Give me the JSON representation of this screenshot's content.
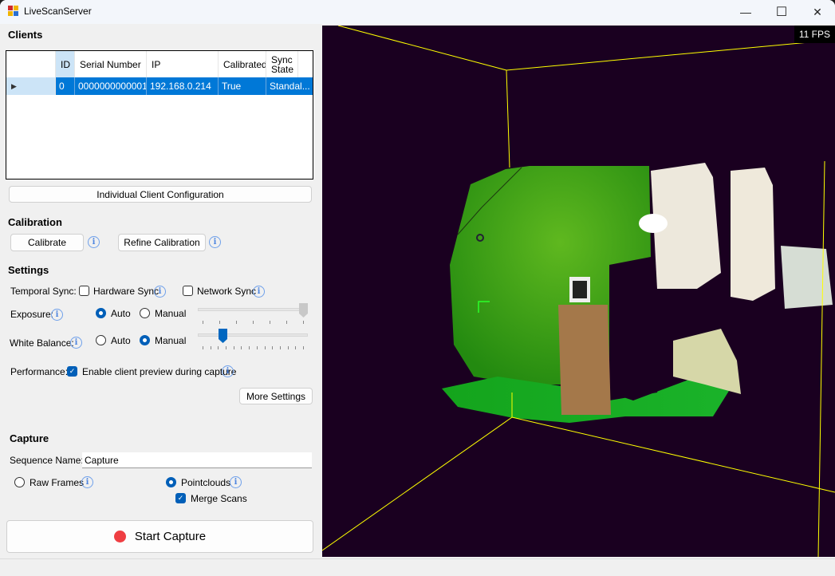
{
  "window": {
    "title": "LiveScanServer",
    "controls": {
      "minimize": "—",
      "maximize": "☐",
      "close": "✕"
    }
  },
  "clients": {
    "heading": "Clients",
    "columns": [
      "ID",
      "Serial Number",
      "IP",
      "Calibrated",
      "Sync State"
    ],
    "rows": [
      {
        "id": "0",
        "serial": "0000000000001",
        "ip": "192.168.0.214",
        "calibrated": "True",
        "sync_state": "Standal..."
      }
    ],
    "row_marker": "▶",
    "config_button": "Individual Client Configuration"
  },
  "calibration": {
    "heading": "Calibration",
    "calibrate_button": "Calibrate",
    "refine_button": "Refine Calibration"
  },
  "settings": {
    "heading": "Settings",
    "temporal_sync_label": "Temporal Sync:",
    "hardware_sync": {
      "label": "Hardware Sync",
      "checked": false
    },
    "network_sync": {
      "label": "Network Sync",
      "checked": false
    },
    "exposure": {
      "label": "Exposure:",
      "auto_label": "Auto",
      "manual_label": "Manual",
      "mode": "Auto",
      "slider_value": 1.0,
      "ticks": 7,
      "enabled": false
    },
    "white_balance": {
      "label": "White Balance:",
      "auto_label": "Auto",
      "manual_label": "Manual",
      "mode": "Manual",
      "slider_value": 0.2,
      "ticks": 14,
      "enabled": true
    },
    "performance_label": "Performance:",
    "client_preview": {
      "label": "Enable client preview during capture",
      "checked": true
    },
    "more_settings_button": "More Settings"
  },
  "capture": {
    "heading": "Capture",
    "sequence_name_label": "Sequence Name:",
    "sequence_name_value": "Capture",
    "raw_frames": {
      "label": "Raw Frames",
      "selected": false
    },
    "pointclouds": {
      "label": "Pointclouds",
      "selected": true
    },
    "merge_scans": {
      "label": "Merge Scans",
      "checked": true
    },
    "start_button": "Start Capture",
    "record_color": "#e8383b"
  },
  "viewport": {
    "fps": "11 FPS",
    "background": "#1a0020",
    "bounding_box_color": "#ffff00"
  },
  "colors": {
    "accent": "#0078d7",
    "selection_header": "#cce4f7",
    "info_icon": "#4f86e0"
  }
}
